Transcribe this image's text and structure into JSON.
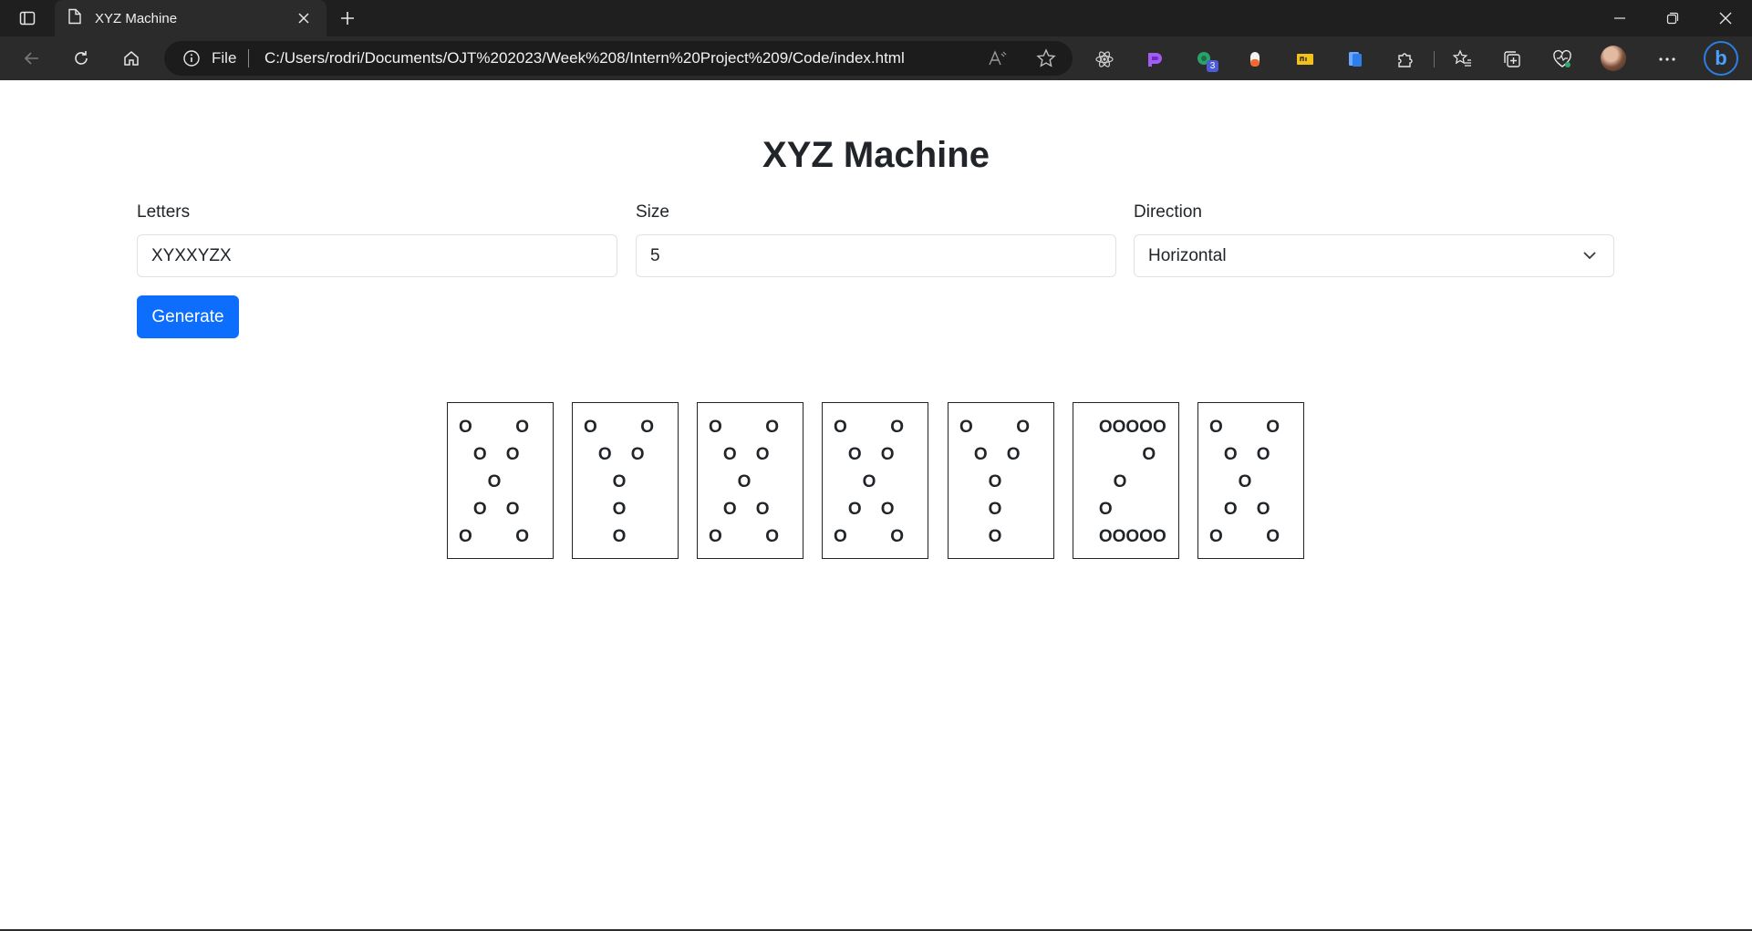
{
  "browser": {
    "tab_title": "XYZ Machine",
    "address_scheme": "File",
    "address_url": "C:/Users/rodri/Documents/OJT%202023/Week%208/Intern%20Project%209/Code/index.html",
    "extension_badge": "3"
  },
  "page": {
    "title": "XYZ Machine",
    "letters_label": "Letters",
    "letters_value": "XYXXYZX",
    "size_label": "Size",
    "size_value": "5",
    "direction_label": "Direction",
    "direction_value": "Horizontal",
    "generate_label": "Generate"
  },
  "output": {
    "patterns": [
      "O         O\n   O    O\n      O\n   O    O\nO         O",
      "O         O\n   O    O\n      O\n      O\n      O",
      "O         O\n   O    O\n      O\n   O    O\nO         O",
      "O         O\n   O    O\n      O\n   O    O\nO         O",
      "O         O\n   O    O\n      O\n      O\n      O",
      "   OOOOO\n            O\n      O\n   O\n   OOOOO",
      "O         O\n   O    O\n      O\n   O    O\nO         O"
    ]
  }
}
